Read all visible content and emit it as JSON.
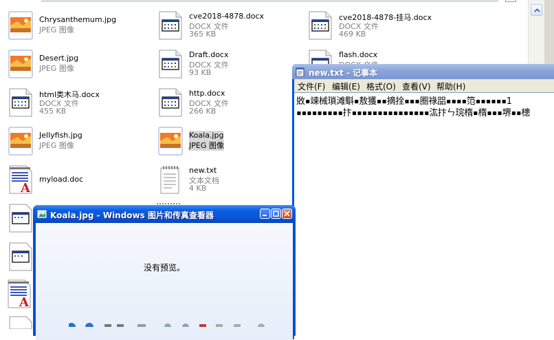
{
  "explorer": {
    "files": [
      {
        "name": "Chrysanthemum.jpg",
        "type": "JPEG 图像",
        "size": ""
      },
      {
        "name": "cve2018-4878.docx",
        "type": "DOCX 文件",
        "size": "365 KB"
      },
      {
        "name": "cve2018-4878-挂马.docx",
        "type": "DOCX 文件",
        "size": "469 KB"
      },
      {
        "name": "Desert.jpg",
        "type": "JPEG 图像",
        "size": ""
      },
      {
        "name": "Draft.docx",
        "type": "DOCX 文件",
        "size": "93 KB"
      },
      {
        "name": "flash.docx",
        "type": "DOCX 文件",
        "size": ""
      },
      {
        "name": "html类木马.docx",
        "type": "DOCX 文件",
        "size": "455 KB"
      },
      {
        "name": "http.docx",
        "type": "DOCX 文件",
        "size": "266 KB"
      },
      {
        "name": "Jellyfish.jpg",
        "type": "JPEG 图像",
        "size": ""
      },
      {
        "name": "Koala.jpg",
        "type": "JPEG 图像",
        "size": ""
      },
      {
        "name": "myload.doc",
        "type": "",
        "size": ""
      },
      {
        "name": "new.txt",
        "type": "文本文档",
        "size": "4 KB"
      }
    ]
  },
  "notepad": {
    "title": "new.txt - 记事本",
    "menu": [
      "文件(F)",
      "编辑(E)",
      "格式(O)",
      "查看(V)",
      "帮助(H)"
    ],
    "lines": [
      "敚▪竦械瑣滩斣▪敖獲▪▪摘拴▪▪▪圈祿㗊▪▪▪▪笵▪▪▪▪▪▪1",
      "▪▪▪▪▪▪▪▪▪抃▪▪▪▪▪▪▪▪▪▪▪▪▪▪▪汯抃ㄣ琓楕▪楕▪▪▪堺▪▪槵"
    ]
  },
  "viewer": {
    "title": "Koala.jpg - Windows 图片和传真查看器",
    "preview_text": "没有预览。"
  },
  "colors": {
    "xp_blue": "#0054e3",
    "notepad_title_inactive": "#8aa4d8",
    "viewer_title_active": "#0a5ee0"
  }
}
